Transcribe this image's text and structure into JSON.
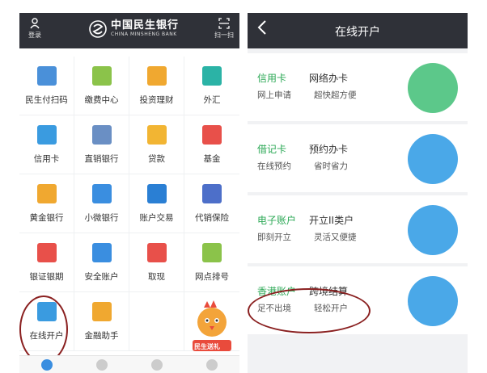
{
  "left": {
    "header": {
      "login": "登录",
      "brand_cn": "中国民生银行",
      "brand_en": "CHINA MINSHENG BANK",
      "scan": "扫一扫"
    },
    "tiles": [
      {
        "label": "民生付扫码",
        "icon": "qr-pay-icon",
        "color": "#4a90d9"
      },
      {
        "label": "缴费中心",
        "icon": "wallet-icon",
        "color": "#8bc34a"
      },
      {
        "label": "投资理财",
        "icon": "yuan-bag-icon",
        "color": "#f0a830"
      },
      {
        "label": "外汇",
        "icon": "currency-exchange-icon",
        "color": "#2bb3a6"
      },
      {
        "label": "信用卡",
        "icon": "credit-card-icon",
        "color": "#3a9be0"
      },
      {
        "label": "直销银行",
        "icon": "direct-bank-icon",
        "color": "#6a8fc4"
      },
      {
        "label": "贷款",
        "icon": "loan-bag-icon",
        "color": "#f2b533"
      },
      {
        "label": "基金",
        "icon": "fund-chart-icon",
        "color": "#e8504a"
      },
      {
        "label": "黄金银行",
        "icon": "gold-au-icon",
        "color": "#f0a830"
      },
      {
        "label": "小微银行",
        "icon": "building-icon",
        "color": "#3a8ee0"
      },
      {
        "label": "账户交易",
        "icon": "trade-chart-icon",
        "color": "#2a7fd4"
      },
      {
        "label": "代销保险",
        "icon": "shield-icon",
        "color": "#4d6fc9"
      },
      {
        "label": "银证银期",
        "icon": "bar-chart-icon",
        "color": "#e8504a"
      },
      {
        "label": "安全账户",
        "icon": "secure-shield-icon",
        "color": "#3a8ee0"
      },
      {
        "label": "取现",
        "icon": "cash-box-icon",
        "color": "#e8504a"
      },
      {
        "label": "网点排号",
        "icon": "location-pin-icon",
        "color": "#8bc34a"
      },
      {
        "label": "在线开户",
        "icon": "open-account-icon",
        "color": "#3a9be0"
      },
      {
        "label": "金融助手",
        "icon": "assistant-grid-icon",
        "color": "#f0a830"
      },
      {
        "label": "",
        "icon": "",
        "color": ""
      },
      {
        "label": "",
        "icon": "",
        "color": ""
      }
    ],
    "promo_text": "民生送礼"
  },
  "right": {
    "header": {
      "back": "<",
      "title": "在线开户"
    },
    "cards": [
      {
        "t1": "信用卡",
        "t2": "网上申请",
        "t3": "网络办卡",
        "t4": "超快超方便",
        "art": "computer-phone-icon",
        "art_bg": "#5cc88a"
      },
      {
        "t1": "借记卡",
        "t2": "在线预约",
        "t3": "预约办卡",
        "t4": "省时省力",
        "art": "debit-card-icon",
        "art_bg": "#4aa8e8"
      },
      {
        "t1": "电子账户",
        "t2": "即刻开立",
        "t3": "开立II类户",
        "t4": "灵活又便捷",
        "art": "mobile-account-icon",
        "art_bg": "#4aa8e8"
      },
      {
        "t1": "香港账户",
        "t2": "足不出境",
        "t3": "跨境结算",
        "t4": "轻松开户",
        "art": "globe-money-icon",
        "art_bg": "#4aa8e8"
      }
    ]
  }
}
